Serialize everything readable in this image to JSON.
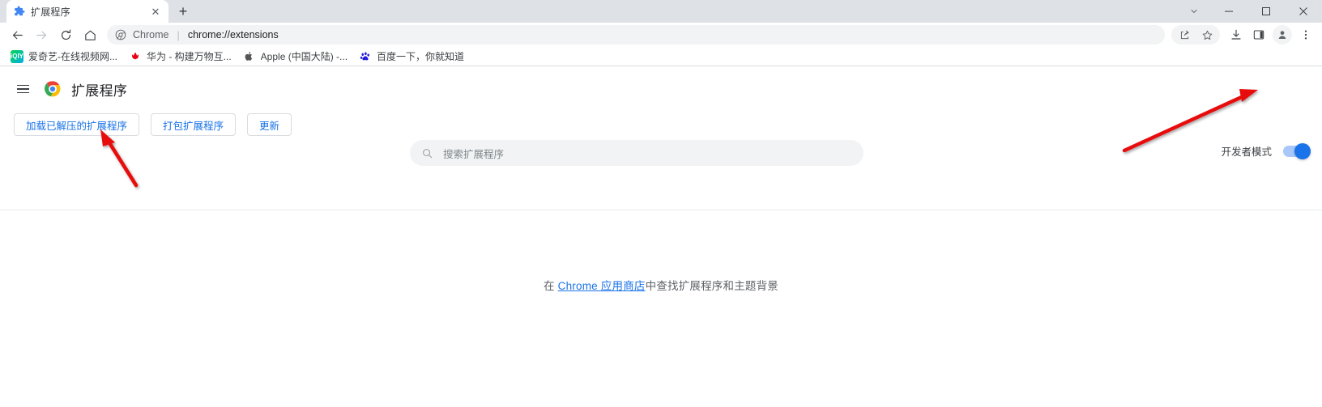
{
  "window": {
    "controls": [
      {
        "name": "tab-search",
        "glyph": "⌄"
      },
      {
        "name": "minimize",
        "glyph": "—"
      },
      {
        "name": "maximize",
        "glyph": "□"
      },
      {
        "name": "close",
        "glyph": "✕"
      }
    ]
  },
  "tabstrip": {
    "tab": {
      "title": "扩展程序",
      "favicon": "puzzle-piece-icon",
      "close_label": "✕"
    },
    "new_tab_label": "+"
  },
  "toolbar": {
    "back_label": "←",
    "forward_label": "→",
    "reload_label": "⟳",
    "home_label": "⌂",
    "omnibox": {
      "chip": "Chrome",
      "separator": "|",
      "url": "chrome://extensions"
    },
    "share_label": "share-icon",
    "bookmark_star_label": "☆",
    "download_label": "download-icon",
    "side_panel_label": "side-panel-icon",
    "profile_label": "avatar-icon",
    "menu_label": "⋮"
  },
  "bookmarks": [
    {
      "label": "爱奇艺-在线视频网...",
      "icon_text": "iQIY",
      "icon_color": "#00be06"
    },
    {
      "label": "华为 - 构建万物互...",
      "icon_text": "",
      "icon_color": "#ffffff"
    },
    {
      "label": "Apple (中国大陆) -...",
      "icon_text": "",
      "icon_color": "#ffffff"
    },
    {
      "label": "百度一下，你就知道",
      "icon_text": "",
      "icon_color": "#ffffff"
    }
  ],
  "extensions_page": {
    "menu_label": "hamburger-menu",
    "logo_label": "chrome-logo",
    "title": "扩展程序",
    "search": {
      "placeholder": "搜索扩展程序",
      "icon": "search-icon"
    },
    "dev_mode": {
      "label": "开发者模式",
      "enabled": true
    },
    "action_buttons": [
      {
        "label": "加载已解压的扩展程序",
        "name": "load-unpacked-button"
      },
      {
        "label": "打包扩展程序",
        "name": "pack-extension-button"
      },
      {
        "label": "更新",
        "name": "update-button"
      }
    ],
    "empty_state": {
      "prefix": "在 ",
      "link": "Chrome 应用商店",
      "suffix": "中查找扩展程序和主题背景"
    }
  },
  "annotations": [
    {
      "name": "arrow-to-load-unpacked",
      "color": "#e8110f"
    },
    {
      "name": "arrow-to-dev-mode-toggle",
      "color": "#e8110f"
    }
  ],
  "colors": {
    "accent_blue": "#1a73e8",
    "toggle_on": "#1a73e8",
    "annotation_red": "#e8110f",
    "tabstrip_bg": "#dee1e6"
  }
}
